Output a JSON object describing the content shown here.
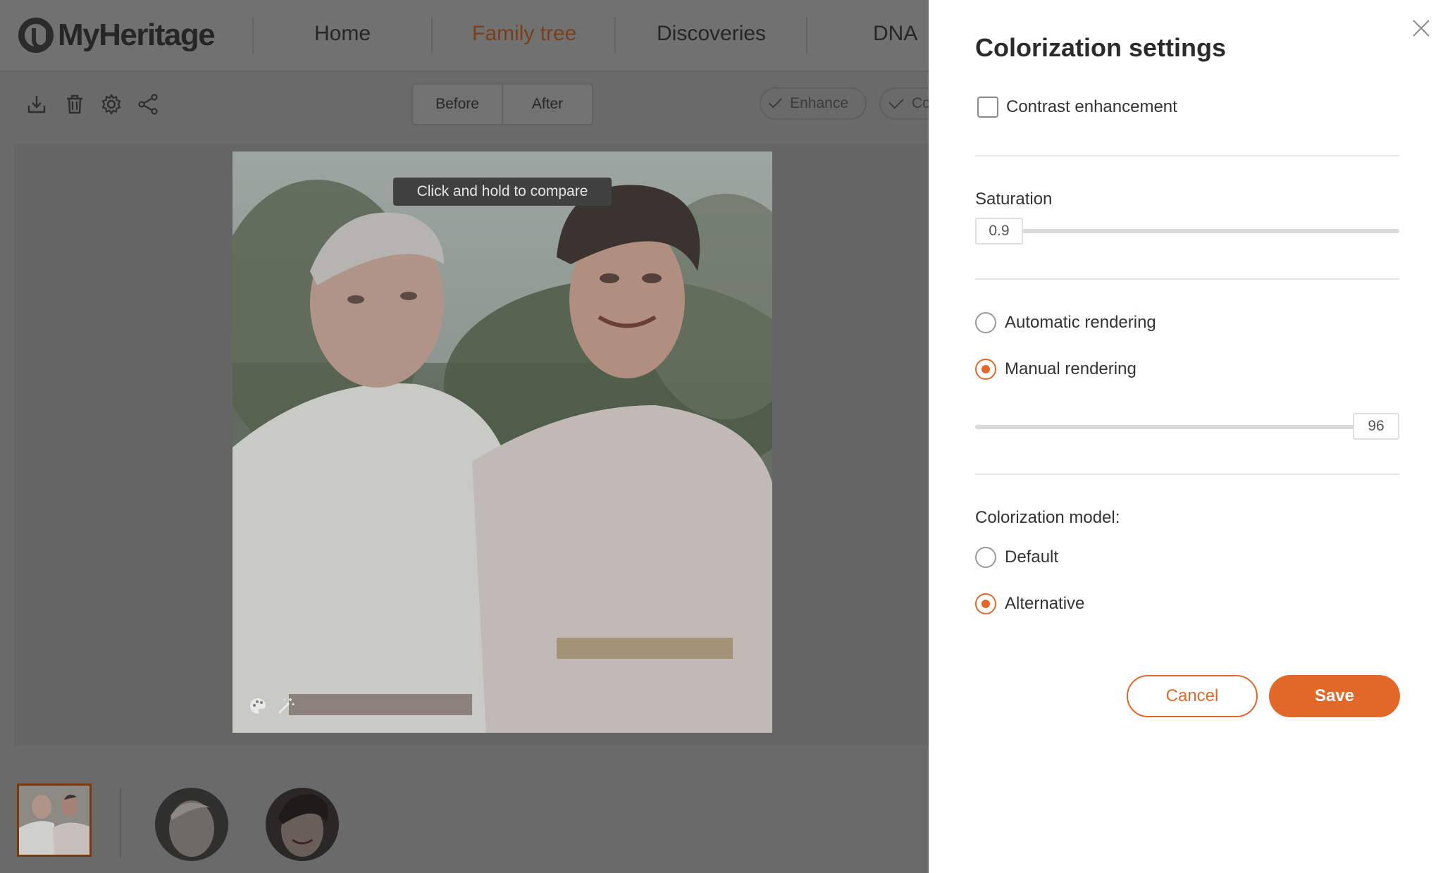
{
  "brand": {
    "name": "MyHeritage"
  },
  "nav": {
    "items": [
      {
        "label": "Home"
      },
      {
        "label": "Family tree",
        "active": true
      },
      {
        "label": "Discoveries"
      },
      {
        "label": "DNA"
      }
    ]
  },
  "toolbar": {
    "icons": [
      "download-icon",
      "trash-icon",
      "gear-icon",
      "share-icon"
    ],
    "compare": {
      "before": "Before",
      "after": "After"
    },
    "enhance_label": "Enhance",
    "colorize_label_partial": "Co"
  },
  "photo": {
    "tooltip": "Click and hold to compare",
    "icons": [
      "palette-icon",
      "magic-wand-icon"
    ]
  },
  "panel": {
    "title": "Colorization settings",
    "contrast": {
      "label": "Contrast enhancement",
      "checked": false
    },
    "saturation": {
      "label": "Saturation",
      "value": "0.9",
      "fraction": 0.05
    },
    "rendering": {
      "automatic": "Automatic rendering",
      "manual": "Manual rendering",
      "selected": "manual",
      "value": "96",
      "fraction": 0.96
    },
    "model": {
      "label": "Colorization model:",
      "default": "Default",
      "alternative": "Alternative",
      "selected": "alternative"
    },
    "cancel": "Cancel",
    "save": "Save"
  },
  "colors": {
    "accent": "#e2682a",
    "overlay": "#6a6a6a",
    "panel_bg": "#ffffff"
  }
}
